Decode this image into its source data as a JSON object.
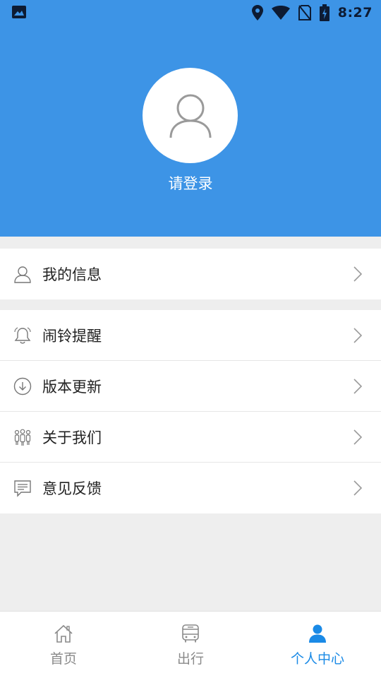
{
  "status_bar": {
    "time": "8:27",
    "icons": [
      "image-icon",
      "location-icon",
      "wifi-icon",
      "no-sim-icon",
      "battery-charging-icon"
    ]
  },
  "profile": {
    "avatar_icon": "user-outline-icon",
    "login_text": "请登录"
  },
  "menu": {
    "group1": [
      {
        "label": "我的信息",
        "icon": "person-icon"
      }
    ],
    "group2": [
      {
        "label": "闹铃提醒",
        "icon": "bell-icon"
      },
      {
        "label": "版本更新",
        "icon": "download-circle-icon"
      },
      {
        "label": "关于我们",
        "icon": "team-icon"
      },
      {
        "label": "意见反馈",
        "icon": "message-icon"
      }
    ]
  },
  "tabbar": {
    "tabs": [
      {
        "label": "首页",
        "icon": "home-icon",
        "active": false
      },
      {
        "label": "出行",
        "icon": "bus-icon",
        "active": false
      },
      {
        "label": "个人中心",
        "icon": "user-filled-icon",
        "active": true
      }
    ]
  },
  "colors": {
    "header_bg": "#3d94e6",
    "accent": "#1a8ae6",
    "page_bg": "#eeeeee"
  }
}
